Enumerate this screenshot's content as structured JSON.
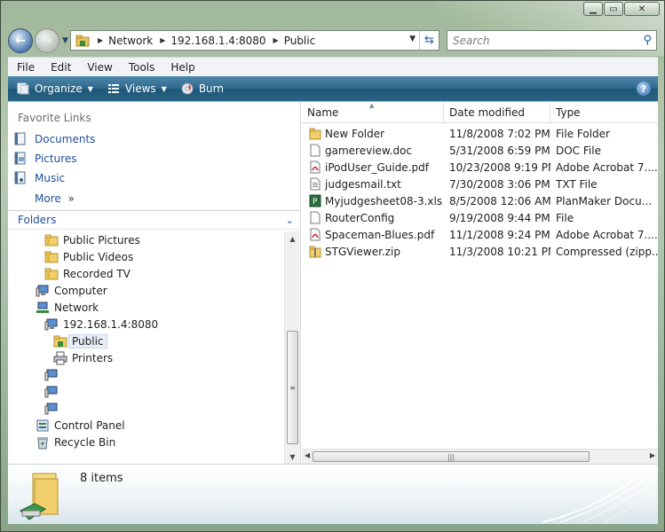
{
  "address": {
    "segments": [
      "Network",
      "192.168.1.4:8080",
      "Public"
    ]
  },
  "search": {
    "placeholder": "Search"
  },
  "menu": [
    "File",
    "Edit",
    "View",
    "Tools",
    "Help"
  ],
  "commands": {
    "organize": "Organize",
    "views": "Views",
    "burn": "Burn"
  },
  "favorites": {
    "header": "Favorite Links",
    "items": [
      "Documents",
      "Pictures",
      "Music"
    ],
    "more": "More"
  },
  "folders": {
    "header": "Folders",
    "tree": [
      "Public Pictures",
      "Public Videos",
      "Recorded TV",
      "Computer",
      "Network",
      "192.168.1.4:8080",
      "Public",
      "Printers",
      "Control Panel",
      "Recycle Bin"
    ]
  },
  "columns": {
    "name": "Name",
    "date": "Date modified",
    "type": "Type"
  },
  "files": [
    {
      "name": "New Folder",
      "date": "11/8/2008 7:02 PM",
      "type": "File Folder",
      "icon": "folder-icon"
    },
    {
      "name": "gamereview.doc",
      "date": "5/31/2008 6:59 PM",
      "type": "DOC File",
      "icon": "document-icon"
    },
    {
      "name": "iPodUser_Guide.pdf",
      "date": "10/23/2008 9:19 PM",
      "type": "Adobe Acrobat 7....",
      "icon": "pdf-icon"
    },
    {
      "name": "judgesmail.txt",
      "date": "7/30/2008 3:06 PM",
      "type": "TXT File",
      "icon": "text-file-icon"
    },
    {
      "name": "Myjudgesheet08-3.xls",
      "date": "8/5/2008 12:06 AM",
      "type": "PlanMaker Docu...",
      "icon": "spreadsheet-icon"
    },
    {
      "name": "RouterConfig",
      "date": "9/19/2008 9:44 PM",
      "type": "File",
      "icon": "file-icon"
    },
    {
      "name": "Spaceman-Blues.pdf",
      "date": "11/1/2008 9:24 PM",
      "type": "Adobe Acrobat 7....",
      "icon": "pdf-icon"
    },
    {
      "name": "STGViewer.zip",
      "date": "11/3/2008 10:21 PM",
      "type": "Compressed (zipp...",
      "icon": "zip-folder-icon"
    }
  ],
  "details": {
    "count": "8 items"
  },
  "colors": {
    "link": "#1f4f9a",
    "commandbar": "#2e6a8d",
    "selection": "#e8eef6"
  }
}
